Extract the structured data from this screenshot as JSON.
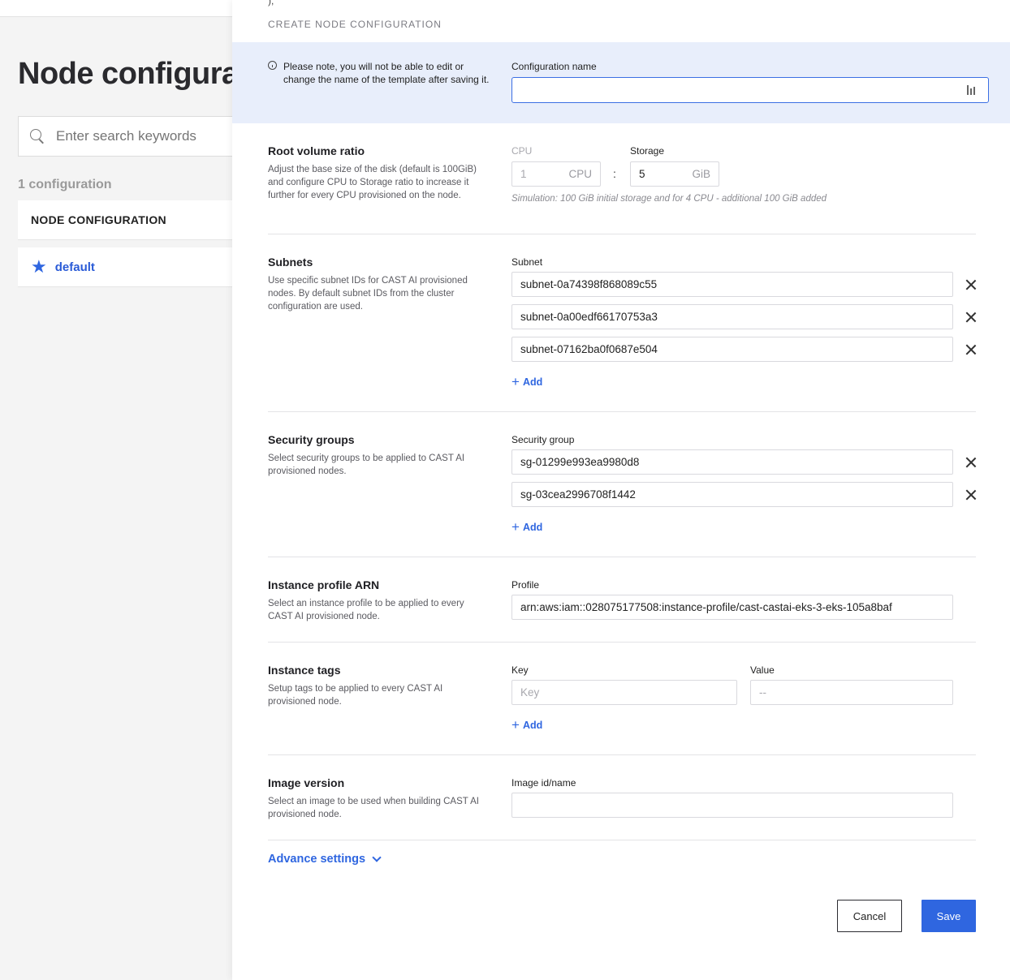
{
  "background": {
    "page_title": "Node configura",
    "search_placeholder": "Enter search keywords",
    "count_label": "1 configuration",
    "table_header": "NODE CONFIGURATION",
    "rows": [
      {
        "name": "default",
        "icon": "star-icon"
      }
    ]
  },
  "drawer": {
    "title": "CREATE NODE CONFIGURATION",
    "top_mark": "),"
  },
  "notice": {
    "text": "Please note, you will not be able to edit or change the name of the template after saving it.",
    "config_name_label": "Configuration name",
    "config_name_value": ""
  },
  "root_volume": {
    "title": "Root volume ratio",
    "description": "Adjust the base size of the disk (default is 100GiB) and configure CPU to Storage ratio to increase it further for every CPU provisioned on the node.",
    "cpu_label": "CPU",
    "cpu_value": "1",
    "cpu_unit": "CPU",
    "separator": ":",
    "storage_label": "Storage",
    "storage_value": "5",
    "storage_unit": "GiB",
    "simulation": "Simulation: 100 GiB initial storage and for 4 CPU - additional 100 GiB added"
  },
  "subnets": {
    "title": "Subnets",
    "description": "Use specific subnet IDs for CAST AI provisioned nodes. By default subnet IDs from the cluster configuration are used.",
    "label": "Subnet",
    "items": [
      "subnet-0a74398f868089c55",
      "subnet-0a00edf66170753a3",
      "subnet-07162ba0f0687e504"
    ],
    "add_label": "Add"
  },
  "security_groups": {
    "title": "Security groups",
    "description": "Select security groups to be applied to CAST AI provisioned nodes.",
    "label": "Security group",
    "items": [
      "sg-01299e993ea9980d8",
      "sg-03cea2996708f1442"
    ],
    "add_label": "Add"
  },
  "instance_profile": {
    "title": "Instance profile ARN",
    "description": "Select an instance profile to be applied to every CAST AI provisioned node.",
    "label": "Profile",
    "value": "arn:aws:iam::028075177508:instance-profile/cast-castai-eks-3-eks-105a8baf"
  },
  "instance_tags": {
    "title": "Instance tags",
    "description": "Setup tags to be applied to every CAST AI provisioned node.",
    "key_label": "Key",
    "value_label": "Value",
    "key_placeholder": "Key",
    "value_placeholder": "--",
    "add_label": "Add"
  },
  "image_version": {
    "title": "Image version",
    "description": "Select an image to be used when building CAST AI provisioned node.",
    "label": "Image id/name",
    "value": ""
  },
  "advance_settings": "Advance settings",
  "buttons": {
    "cancel": "Cancel",
    "save": "Save"
  },
  "colors": {
    "accent": "#2f66e0",
    "notice_bg": "#e8eefb"
  }
}
